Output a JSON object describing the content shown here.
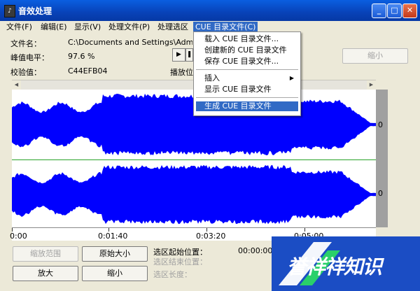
{
  "window": {
    "title": "音效处理"
  },
  "menubar": {
    "items": [
      {
        "label": "文件(F)"
      },
      {
        "label": "编辑(E)"
      },
      {
        "label": "显示(V)"
      },
      {
        "label": "处理文件(P)"
      },
      {
        "label": "处理选区"
      },
      {
        "label": "CUE 目录文件(C)"
      }
    ]
  },
  "info": {
    "filename_label": "文件名：",
    "filename_value": "C:\\Documents and Settings\\Administrato",
    "peak_label": "峰值电平：",
    "peak_value": "97.6 %",
    "checksum_label": "校验值：",
    "checksum_value": "C44EFB04",
    "playpos_label": "播放位"
  },
  "zoomout_top_label": "缩小",
  "dropdown": {
    "items": [
      {
        "label": "载入 CUE 目录文件..."
      },
      {
        "label": "创建新的 CUE 目录文件"
      },
      {
        "label": "保存 CUE 目录文件..."
      },
      {
        "label": "插入",
        "submenu_arrow": "▶"
      },
      {
        "label": "显示 CUE 目录文件"
      },
      {
        "label": "生成 CUE 目录文件"
      }
    ]
  },
  "waveform": {
    "color": "#0000ff",
    "zero_label_top": "0",
    "zero_label_bottom": "0"
  },
  "timeline": {
    "labels": [
      "0:00",
      "0:01:40",
      "0:03:20",
      "0:05:00"
    ]
  },
  "buttons": {
    "zoom_range": "缩放范围",
    "original_size": "原始大小",
    "zoom_in": "放大",
    "zoom_out": "缩小"
  },
  "selection": {
    "start_label": "选区起始位置：",
    "start_value": "00:00:00",
    "end_label": "选区结束位置：",
    "length_label": "选区长度："
  },
  "watermark": {
    "text": "誉祥祥知识"
  }
}
